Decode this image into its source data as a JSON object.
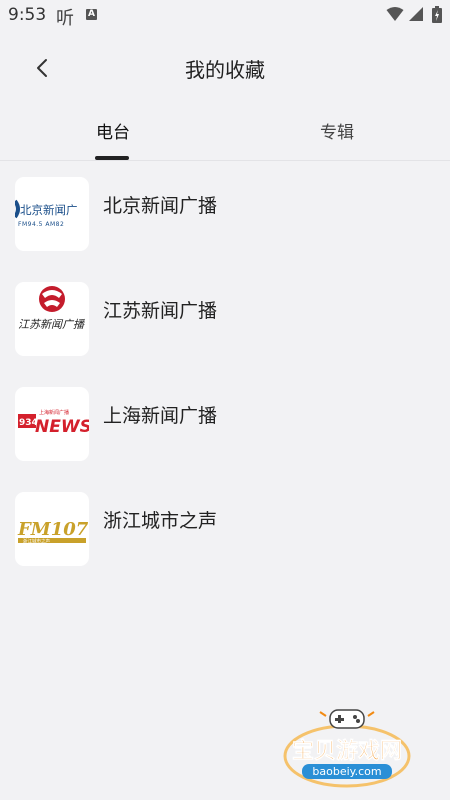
{
  "status": {
    "time": "9:53",
    "ting_char": "听",
    "a_badge": "A"
  },
  "header": {
    "title": "我的收藏"
  },
  "tabs": [
    {
      "label": "电台",
      "active": true
    },
    {
      "label": "专辑",
      "active": false
    }
  ],
  "stations": [
    {
      "name": "北京新闻广播",
      "logo_text": "北京新闻广",
      "logo_sub": "FM94.5  AM82"
    },
    {
      "name": "江苏新闻广播",
      "logo_text": "江苏新闻广播"
    },
    {
      "name": "上海新闻广播",
      "logo_num": "934",
      "logo_text": "NEWS",
      "logo_top": "上海新闻广播"
    },
    {
      "name": "浙江城市之声",
      "logo_text": "FM107",
      "logo_sub": "浙江城市之声"
    }
  ],
  "watermark": {
    "text": "宝贝游戏网",
    "url": "baobeiy.com"
  },
  "colors": {
    "background": "#f2f2f4",
    "beijing_blue": "#1b4f8a",
    "jiangsu_red": "#c41c2c",
    "shanghai_red": "#d4202c",
    "zhejiang_gold": "#c9a12a",
    "watermark_orange": "#f28a12"
  }
}
